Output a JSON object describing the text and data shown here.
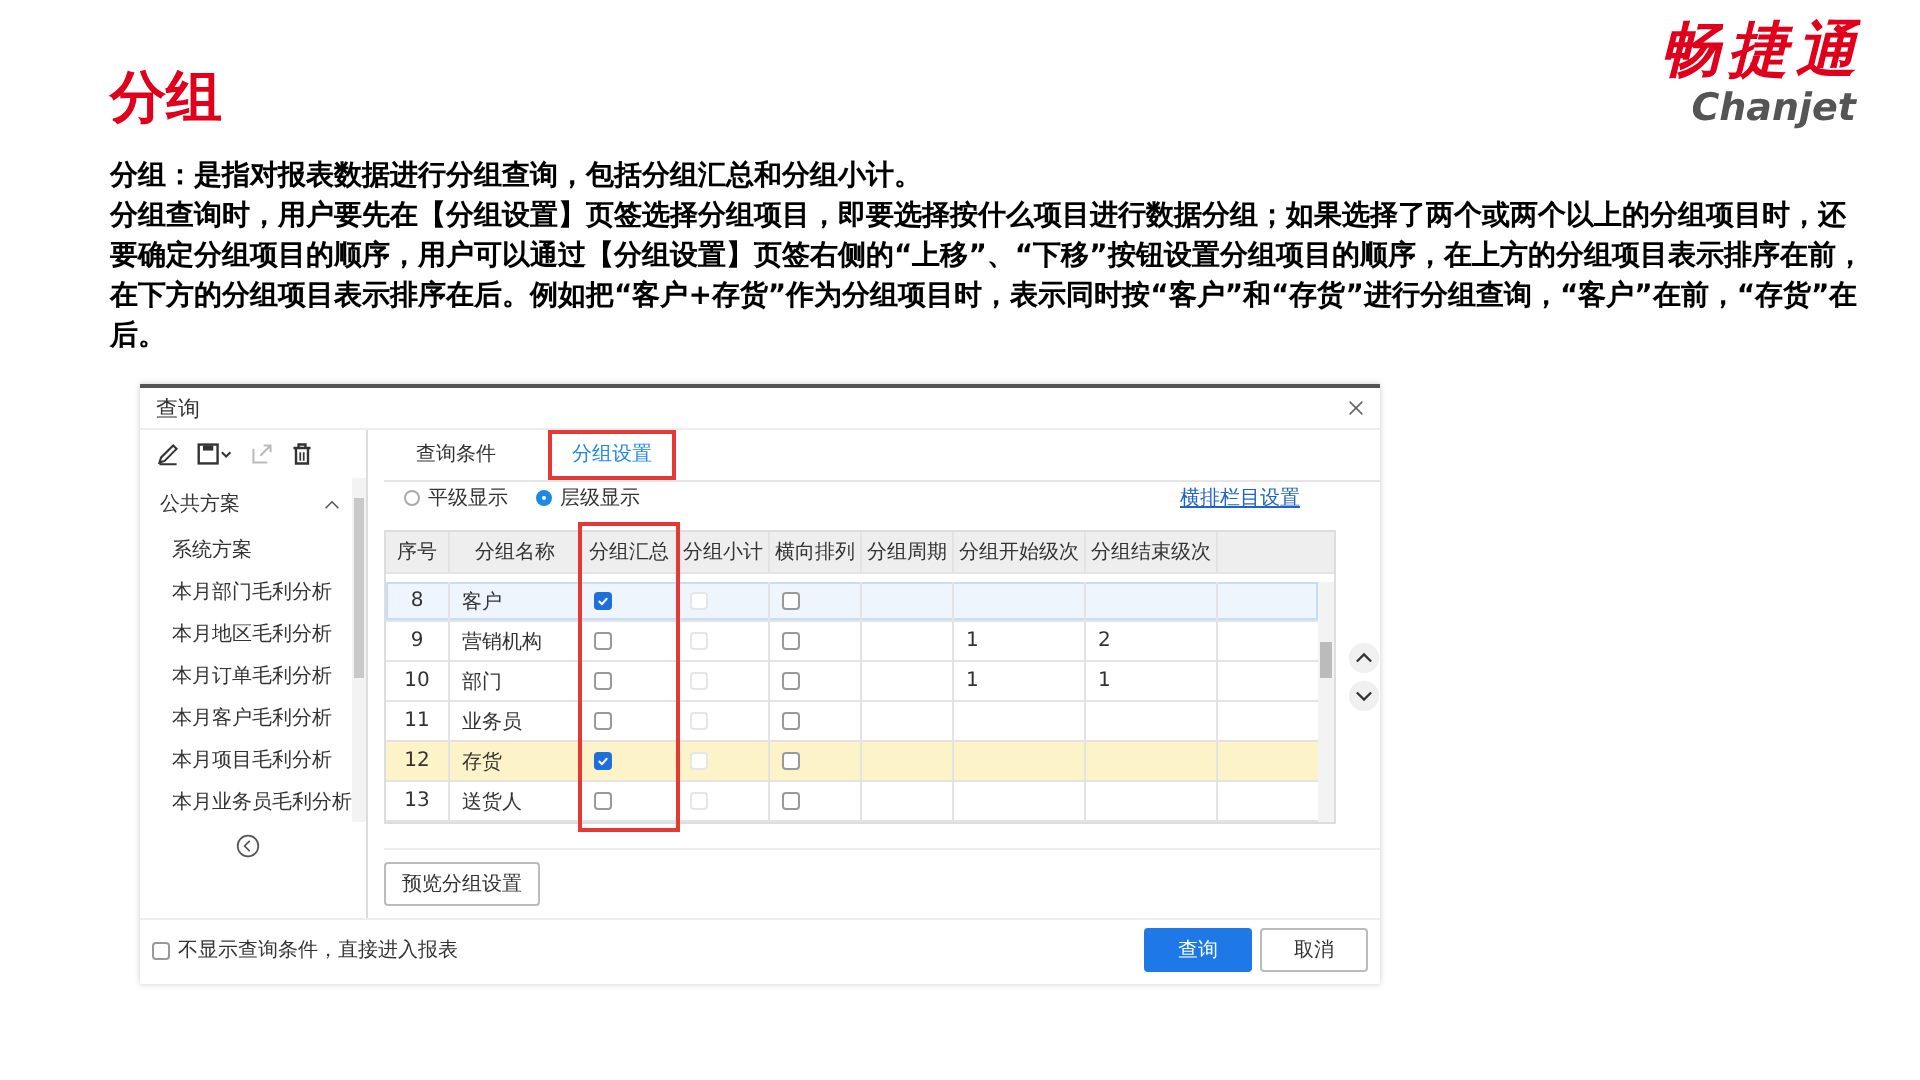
{
  "slide": {
    "title": "分组",
    "logo": {
      "name": "畅捷通",
      "latin": "Chanjet"
    },
    "paragraphs": [
      "分组：是指对报表数据进行分组查询，包括分组汇总和分组小计。",
      "分组查询时，用户要先在【分组设置】页签选择分组项目，即要选择按什么项目进行数据分组；如果选择了两个或两个以上的分组项目时，还要确定分组项目的顺序，用户可以通过【分组设置】页签右侧的“上移”、“下移”按钮设置分组项目的顺序，在上方的分组项目表示排序在前，在下方的分组项目表示排序在后。例如把“客户+存货”作为分组项目时，表示同时按“客户”和“存货”进行分组查询，“客户”在前，“存货”在后。"
    ]
  },
  "dialog": {
    "title": "查询",
    "sidebar": {
      "section": "公共方案",
      "expanded": true,
      "items": [
        "系统方案",
        "本月部门毛利分析",
        "本月地区毛利分析",
        "本月订单毛利分析",
        "本月客户毛利分析",
        "本月项目毛利分析",
        "本月业务员毛利分析"
      ]
    },
    "tabs": [
      {
        "label": "查询条件",
        "selected": false,
        "highlighted": false
      },
      {
        "label": "分组设置",
        "selected": true,
        "highlighted": true
      }
    ],
    "display_modes": [
      {
        "label": "平级显示",
        "selected": false
      },
      {
        "label": "层级显示",
        "selected": true
      }
    ],
    "column_settings_link": "横排栏目设置",
    "table": {
      "columns": [
        {
          "label": "序号",
          "highlighted": false
        },
        {
          "label": "分组名称",
          "highlighted": false
        },
        {
          "label": "分组汇总",
          "highlighted": true
        },
        {
          "label": "分组小计",
          "highlighted": false
        },
        {
          "label": "横向排列",
          "highlighted": false
        },
        {
          "label": "分组周期",
          "highlighted": false
        },
        {
          "label": "分组开始级次",
          "highlighted": false
        },
        {
          "label": "分组结束级次",
          "highlighted": false
        }
      ],
      "rows": [
        {
          "no": "8",
          "name": "客户",
          "summary": true,
          "subtotal": false,
          "subtotal_disabled": true,
          "horizontal": false,
          "start_level": "",
          "end_level": "",
          "selected": true,
          "highlighted": false
        },
        {
          "no": "9",
          "name": "营销机构",
          "summary": false,
          "subtotal": false,
          "subtotal_disabled": true,
          "horizontal": false,
          "start_level": "1",
          "end_level": "2",
          "selected": false,
          "highlighted": false
        },
        {
          "no": "10",
          "name": "部门",
          "summary": false,
          "subtotal": false,
          "subtotal_disabled": true,
          "horizontal": false,
          "start_level": "1",
          "end_level": "1",
          "selected": false,
          "highlighted": false
        },
        {
          "no": "11",
          "name": "业务员",
          "summary": false,
          "subtotal": false,
          "subtotal_disabled": true,
          "horizontal": false,
          "start_level": "",
          "end_level": "",
          "selected": false,
          "highlighted": false
        },
        {
          "no": "12",
          "name": "存货",
          "summary": true,
          "subtotal": false,
          "subtotal_disabled": true,
          "horizontal": false,
          "start_level": "",
          "end_level": "",
          "selected": false,
          "highlighted": true
        },
        {
          "no": "13",
          "name": "送货人",
          "summary": false,
          "subtotal": false,
          "subtotal_disabled": true,
          "horizontal": false,
          "start_level": "",
          "end_level": "",
          "selected": false,
          "highlighted": false
        }
      ]
    },
    "preview_button": "预览分组设置",
    "skip_conditions": {
      "label": "不显示查询条件，直接进入报表",
      "checked": false
    },
    "buttons": [
      {
        "label": "查询",
        "kind": "primary"
      },
      {
        "label": "取消",
        "kind": "secondary"
      }
    ]
  }
}
